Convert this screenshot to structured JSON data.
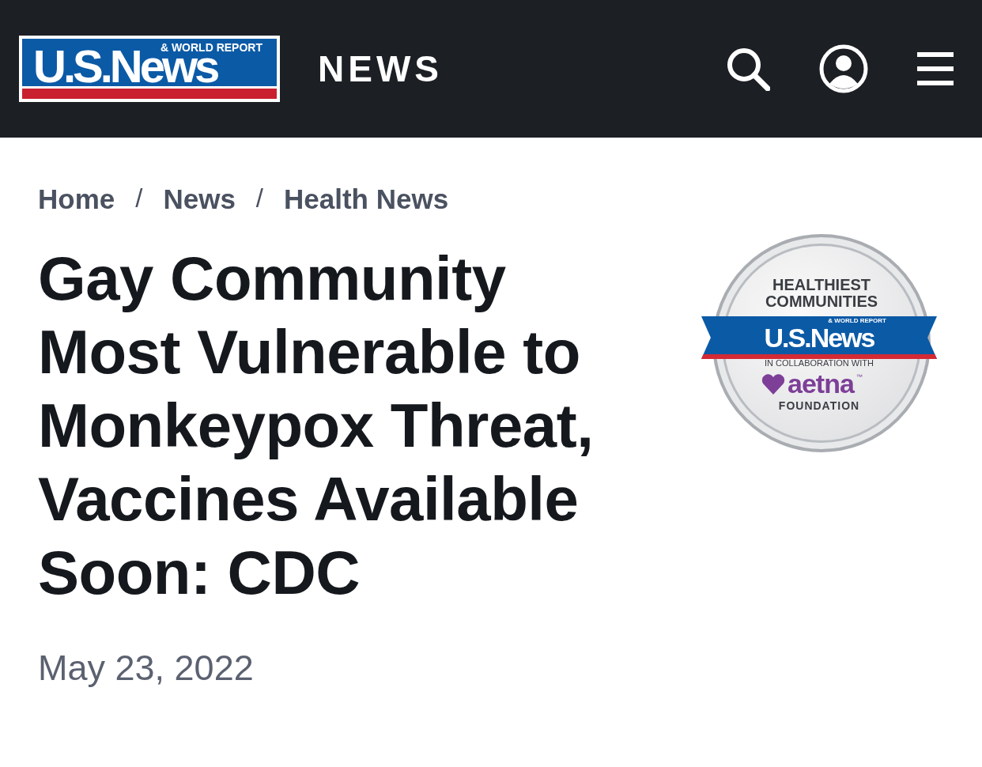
{
  "header": {
    "logo": {
      "tagline": "& WORLD REPORT",
      "wordmark": "U.S.News"
    },
    "section": "NEWS"
  },
  "breadcrumbs": [
    {
      "kind": "link",
      "text": "Home"
    },
    {
      "kind": "separator",
      "text": "/"
    },
    {
      "kind": "link",
      "text": "News"
    },
    {
      "kind": "separator",
      "text": "/"
    },
    {
      "kind": "link",
      "text": "Health News"
    }
  ],
  "article": {
    "title": "Gay Community Most Vulnerable to Monkeypox Threat, Vaccines Available Soon: CDC",
    "date": "May 23, 2022"
  },
  "badge": {
    "title_lines": [
      "HEALTHIEST",
      "COMMUNITIES"
    ],
    "logo": {
      "tagline": "& WORLD REPORT",
      "wordmark": "U.S.News"
    },
    "collab": "IN COLLABORATION WITH",
    "partner": "aetna",
    "trademark": "™",
    "partner_sub": "FOUNDATION"
  }
}
